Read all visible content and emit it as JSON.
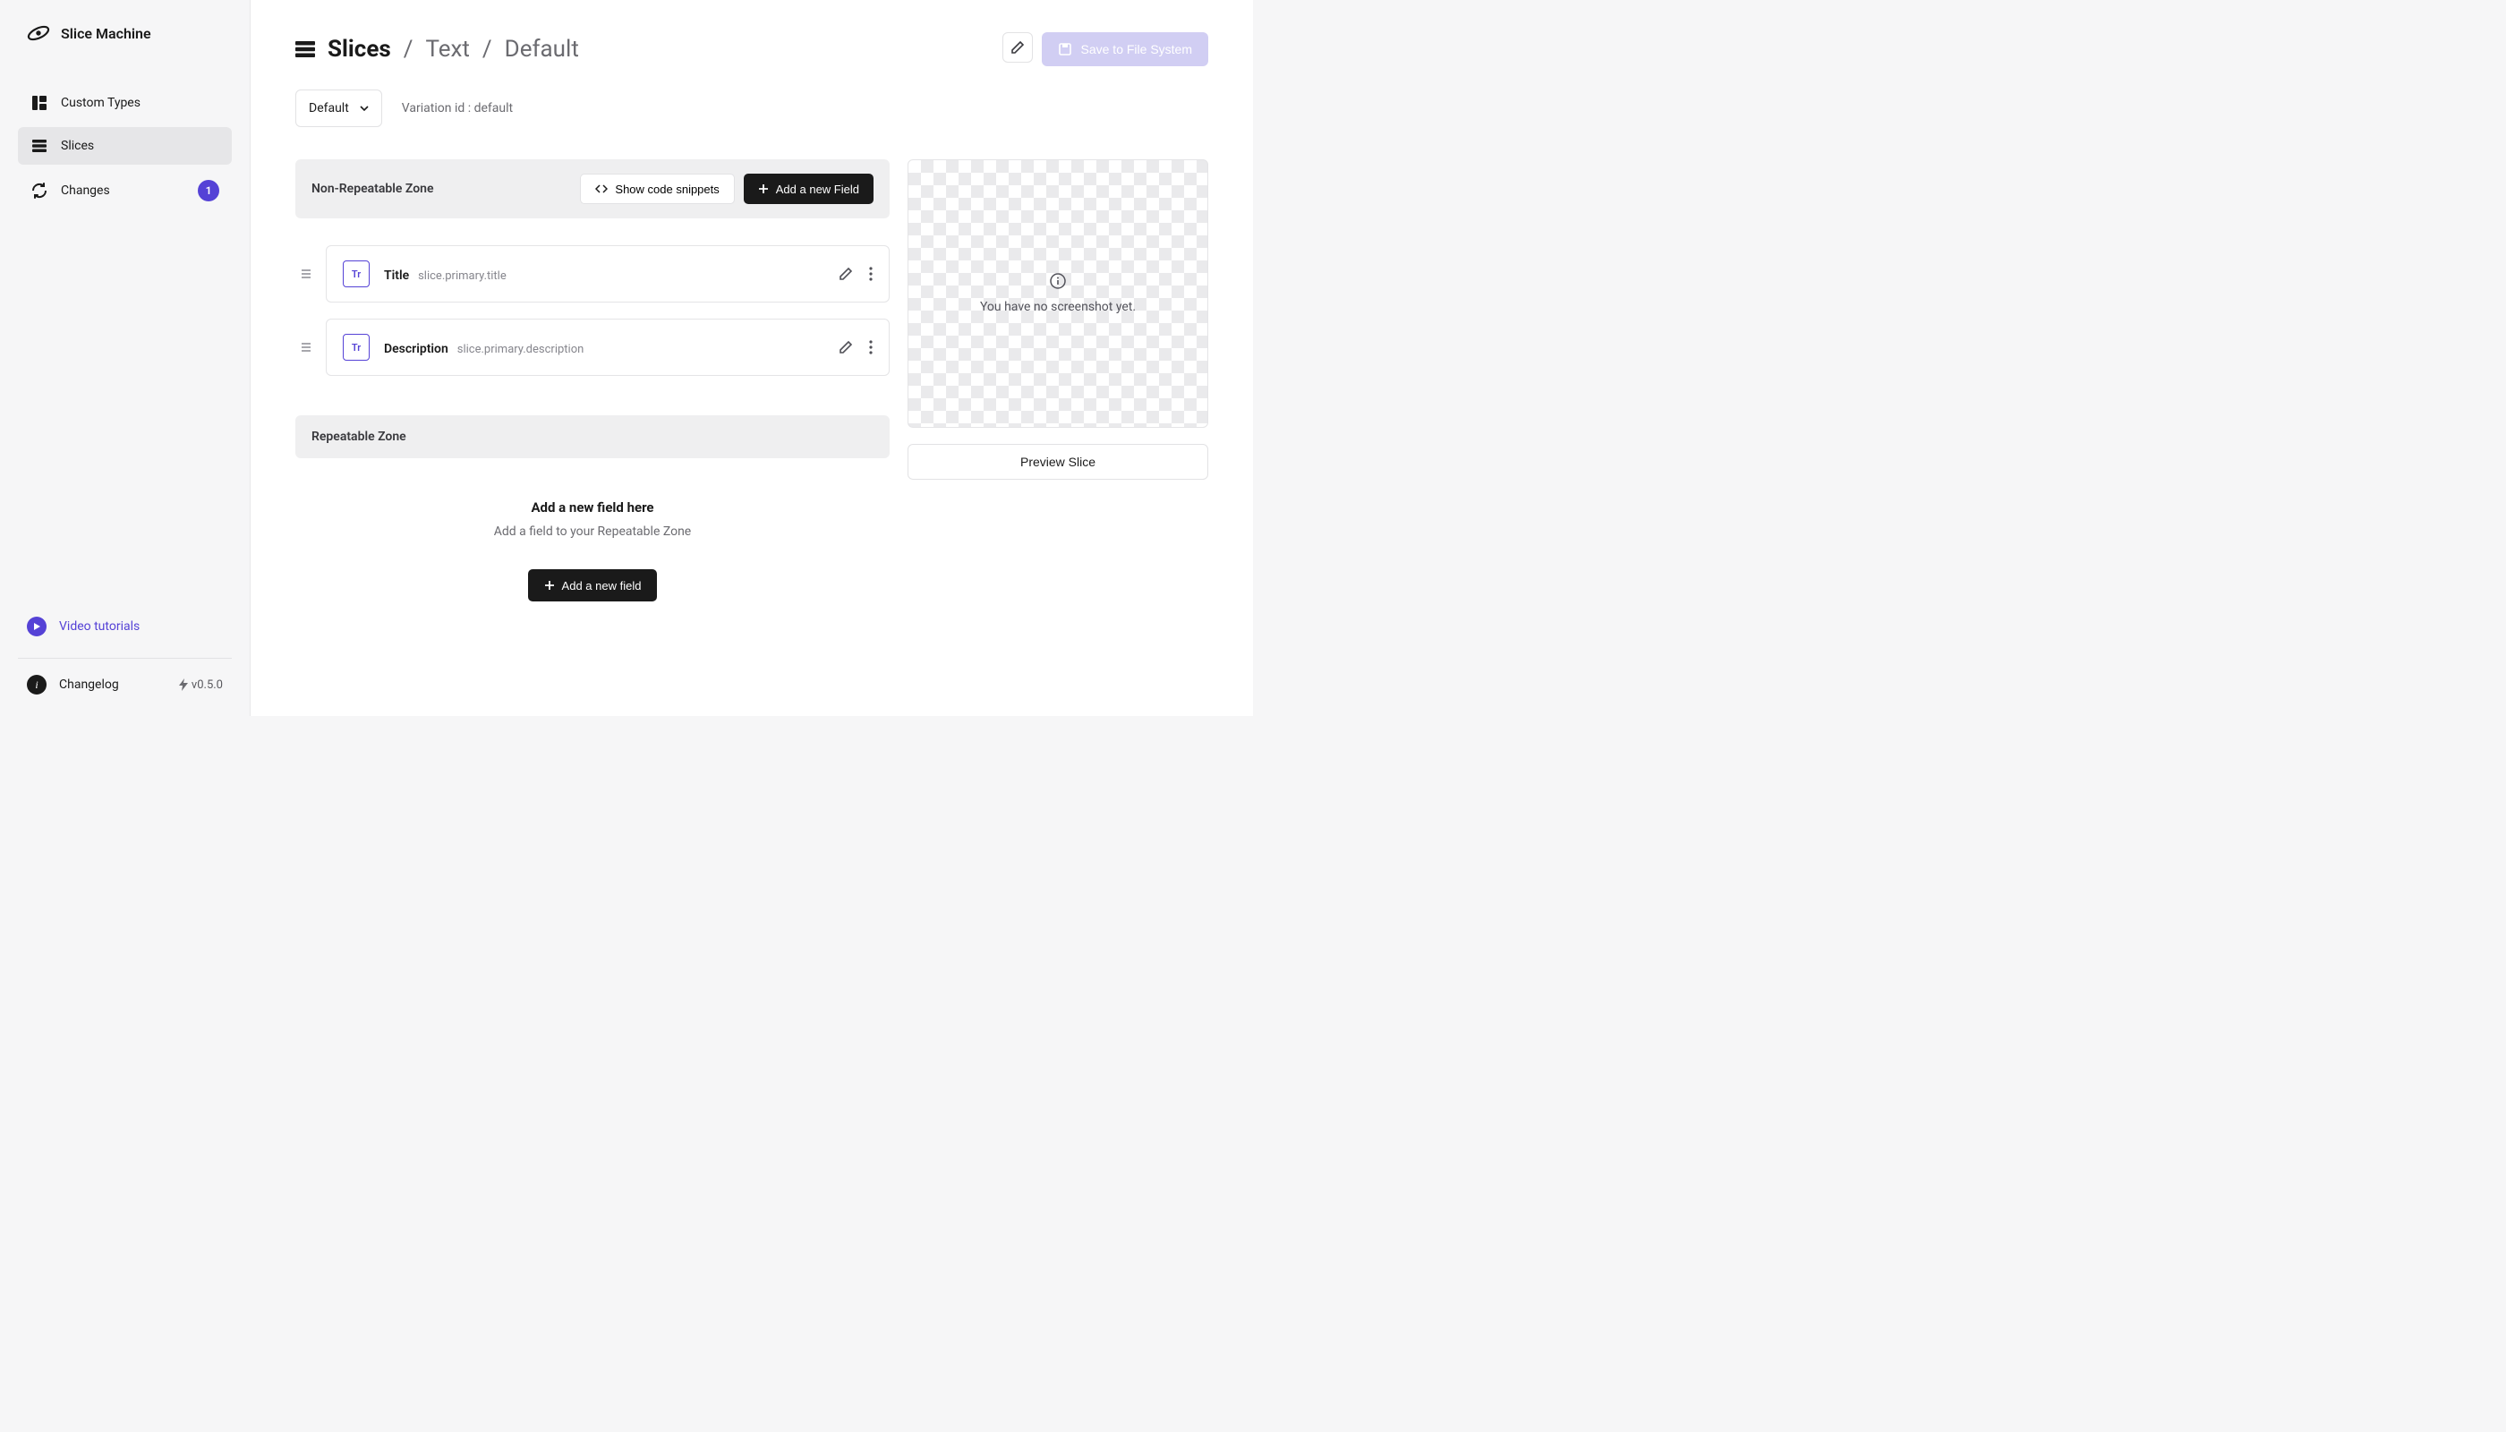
{
  "brand": {
    "name": "Slice Machine"
  },
  "sidebar": {
    "items": [
      {
        "label": "Custom Types"
      },
      {
        "label": "Slices"
      },
      {
        "label": "Changes",
        "badge": "1"
      }
    ],
    "tutorials": "Video tutorials",
    "changelog": "Changelog",
    "version": "v0.5.0"
  },
  "breadcrumb": {
    "root": "Slices",
    "sep1": "/",
    "model": "Text",
    "sep2": "/",
    "variation": "Default"
  },
  "header": {
    "save": "Save to File System"
  },
  "variation": {
    "selected": "Default",
    "idline": "Variation id : default"
  },
  "zone1": {
    "title": "Non-Repeatable Zone",
    "snippets": "Show code snippets",
    "addField": "Add a new Field",
    "fields": [
      {
        "name": "Title",
        "path": "slice.primary.title"
      },
      {
        "name": "Description",
        "path": "slice.primary.description"
      }
    ]
  },
  "zone2": {
    "title": "Repeatable Zone",
    "emptyTitle": "Add a new field here",
    "emptySub": "Add a field to your Repeatable Zone",
    "addField": "Add a new field"
  },
  "preview": {
    "empty": "You have no screenshot yet.",
    "button": "Preview Slice"
  }
}
